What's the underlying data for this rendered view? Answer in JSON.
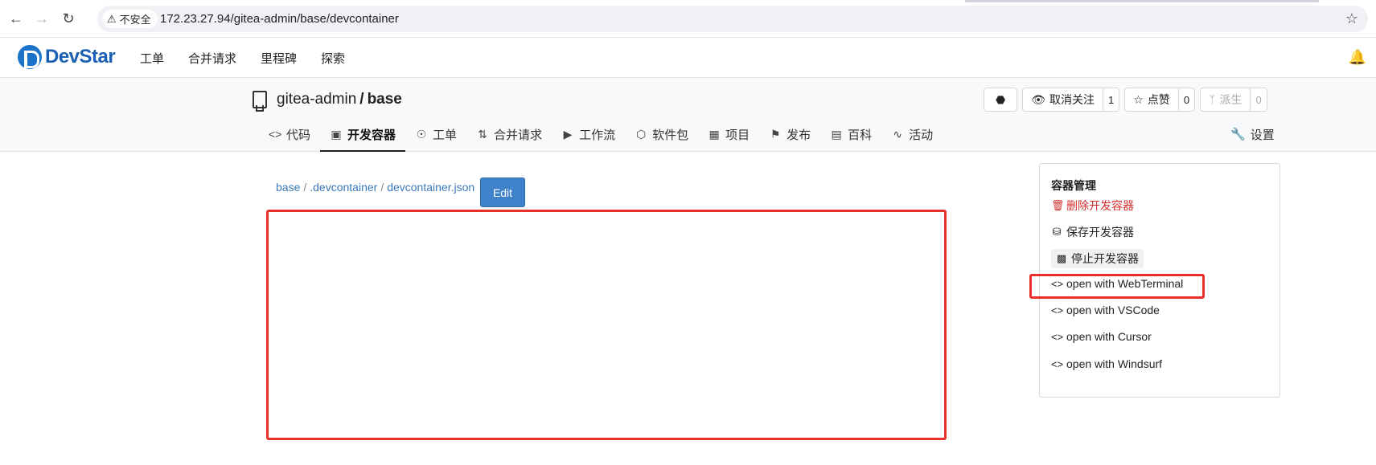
{
  "browser": {
    "insecure_label": "不安全",
    "url": "172.23.27.94/gitea-admin/base/devcontainer"
  },
  "header": {
    "logo_text": "DevStar",
    "nav": [
      "工单",
      "合并请求",
      "里程碑",
      "探索"
    ]
  },
  "repo": {
    "owner": "gitea-admin",
    "separator": "/",
    "name": "base",
    "actions": {
      "unwatch_label": "取消关注",
      "unwatch_count": "1",
      "star_label": "点赞",
      "star_count": "0",
      "fork_label": "派生",
      "fork_count": "0"
    },
    "tabs": [
      {
        "label": "代码",
        "icon": "code-icon"
      },
      {
        "label": "开发容器",
        "icon": "package-icon"
      },
      {
        "label": "工单",
        "icon": "issue-icon"
      },
      {
        "label": "合并请求",
        "icon": "pull-request-icon"
      },
      {
        "label": "工作流",
        "icon": "play-icon"
      },
      {
        "label": "软件包",
        "icon": "box-icon"
      },
      {
        "label": "项目",
        "icon": "project-icon"
      },
      {
        "label": "发布",
        "icon": "tag-icon"
      },
      {
        "label": "百科",
        "icon": "book-icon"
      },
      {
        "label": "活动",
        "icon": "pulse-icon"
      }
    ],
    "settings_label": "设置"
  },
  "content": {
    "breadcrumb": [
      "base",
      ".devcontainer",
      "devcontainer.json"
    ],
    "breadcrumb_sep": "/",
    "edit_label": "Edit"
  },
  "panel": {
    "title": "容器管理",
    "delete_label": "删除开发容器",
    "save_label": "保存开发容器",
    "stop_label": "停止开发容器",
    "open_items": [
      "open with WebTerminal",
      "open with VSCode",
      "open with Cursor",
      "open with Windsurf"
    ]
  },
  "colors": {
    "accent": "#3f82c9",
    "danger": "#d32f2f",
    "highlight": "#e8302a"
  }
}
